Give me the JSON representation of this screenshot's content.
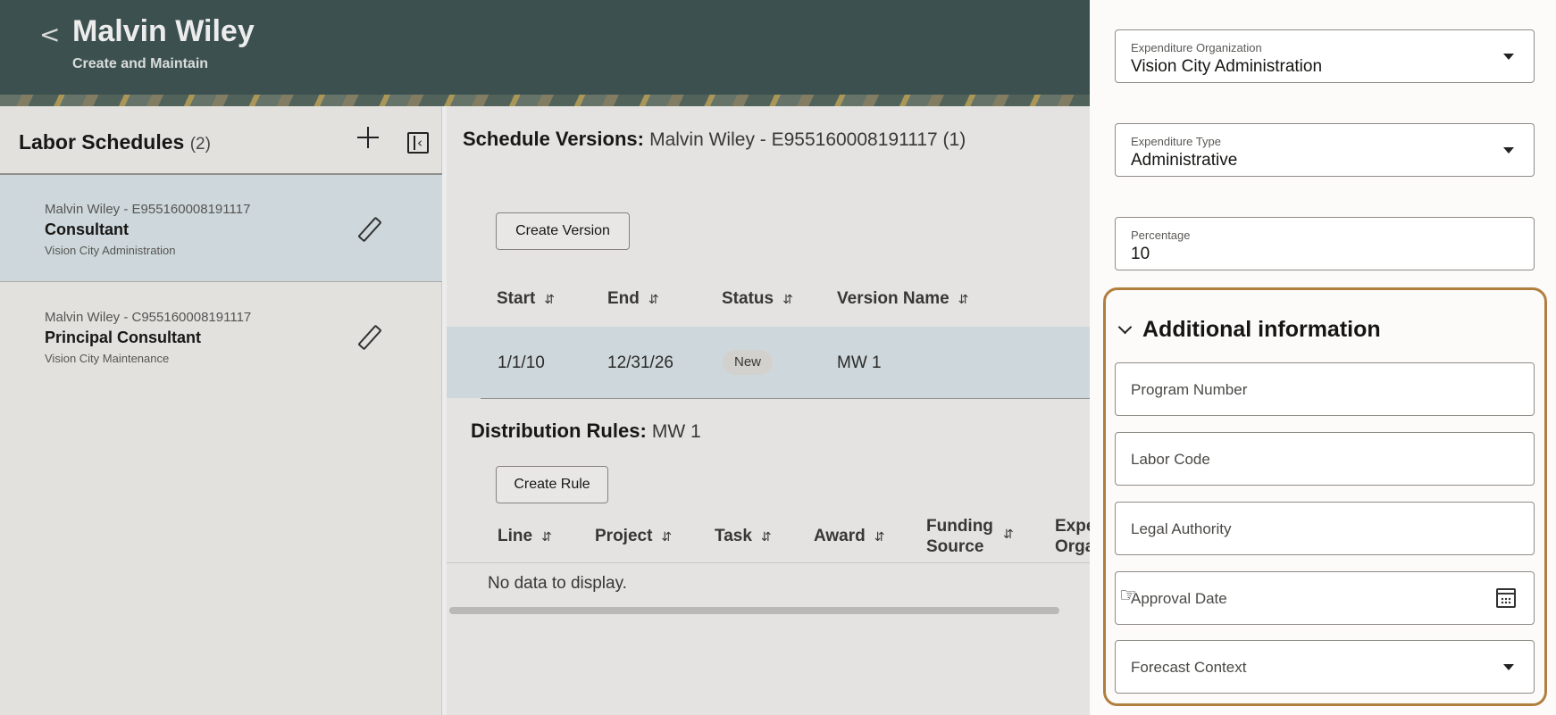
{
  "header": {
    "back": "<",
    "title": "Malvin Wiley",
    "subtitle": "Create and Maintain"
  },
  "labor_schedules": {
    "title": "Labor Schedules",
    "count": "(2)",
    "items": [
      {
        "id": "Malvin Wiley - E955160008191117",
        "role": "Consultant",
        "org": "Vision City Administration"
      },
      {
        "id": "Malvin Wiley - C955160008191117",
        "role": "Principal Consultant",
        "org": "Vision City Maintenance"
      }
    ]
  },
  "schedule_versions": {
    "label": "Schedule Versions:",
    "value": "Malvin Wiley - E955160008191117 (1)",
    "create_button": "Create Version",
    "columns": [
      "Start",
      "End",
      "Status",
      "Version Name"
    ],
    "rows": [
      {
        "start": "1/1/10",
        "end": "12/31/26",
        "status": "New",
        "name": "MW 1"
      }
    ]
  },
  "distribution_rules": {
    "label": "Distribution Rules:",
    "value": "MW 1",
    "create_button": "Create Rule",
    "columns": [
      "Line",
      "Project",
      "Task",
      "Award",
      "Funding\nSource",
      "Expe\nOrga"
    ],
    "empty_text": "No data to display."
  },
  "drawer": {
    "expenditure_org": {
      "label": "Expenditure Organization",
      "value": "Vision City Administration"
    },
    "expenditure_type": {
      "label": "Expenditure Type",
      "value": "Administrative"
    },
    "percentage": {
      "label": "Percentage",
      "value": "10"
    },
    "additional_info": {
      "title": "Additional information",
      "fields": {
        "program_number": "Program Number",
        "labor_code": "Labor Code",
        "legal_authority": "Legal Authority",
        "approval_date": "Approval Date",
        "forecast_context": "Forecast Context"
      }
    }
  },
  "colors": {
    "header_bg": "#3e5553",
    "selected_row": "#dfe9ee",
    "highlight_border": "#b07f3f"
  }
}
